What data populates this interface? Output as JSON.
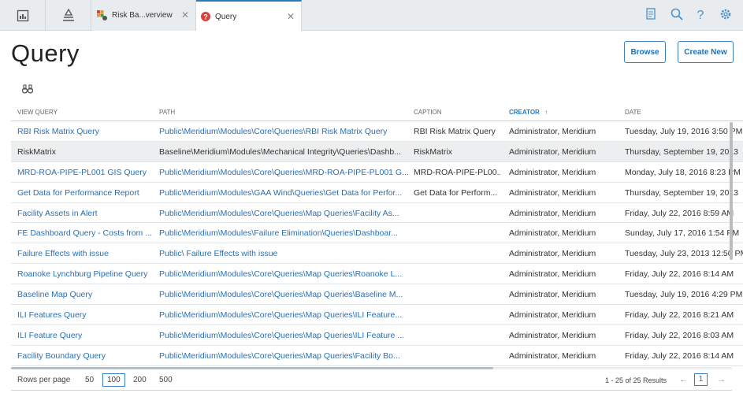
{
  "tabs": {
    "inactive_label": "Risk Ba...verview",
    "active_label": "Query"
  },
  "header": {
    "title": "Query",
    "browse_label": "Browse",
    "create_label": "Create New"
  },
  "table": {
    "columns": [
      "VIEW QUERY",
      "PATH",
      "CAPTION",
      "CREATOR",
      "DATE"
    ],
    "sorted_column": "CREATOR",
    "sort_arrow": "↑",
    "rows": [
      [
        "RBI Risk Matrix Query",
        "Public\\Meridium\\Modules\\Core\\Queries\\RBI Risk Matrix Query",
        "RBI Risk Matrix Query",
        "Administrator, Meridium",
        "Tuesday, July 19, 2016 3:50 PM"
      ],
      [
        "RiskMatrix",
        "Baseline\\Meridium\\Modules\\Mechanical Integrity\\Queries\\Dashb...",
        "RiskMatrix",
        "Administrator, Meridium",
        "Thursday, September 19, 2013"
      ],
      [
        "MRD-ROA-PIPE-PL001 GIS Query",
        "Public\\Meridium\\Modules\\Core\\Queries\\MRD-ROA-PIPE-PL001 G...",
        "MRD-ROA-PIPE-PL00...",
        "Administrator, Meridium",
        "Monday, July 18, 2016 8:23 PM"
      ],
      [
        "Get Data for Performance Report",
        "Public\\Meridium\\Modules\\GAA Wind\\Queries\\Get Data for Perfor...",
        "Get Data for Perform...",
        "Administrator, Meridium",
        "Thursday, September 19, 2013"
      ],
      [
        "Facility Assets in Alert",
        "Public\\Meridium\\Modules\\Core\\Queries\\Map Queries\\Facility As...",
        "",
        "Administrator, Meridium",
        "Friday, July 22, 2016 8:59 AM"
      ],
      [
        "FE Dashboard Query - Costs from ...",
        "Public\\Meridium\\Modules\\Failure Elimination\\Queries\\Dashboar...",
        "",
        "Administrator, Meridium",
        "Sunday, July 17, 2016 1:54 PM"
      ],
      [
        "Failure Effects with issue",
        "Public\\ Failure Effects with issue",
        "",
        "Administrator, Meridium",
        "Tuesday, July 23, 2013 12:50 PM"
      ],
      [
        "Roanoke Lynchburg Pipeline Query",
        "Public\\Meridium\\Modules\\Core\\Queries\\Map Queries\\Roanoke L...",
        "",
        "Administrator, Meridium",
        "Friday, July 22, 2016 8:14 AM"
      ],
      [
        "Baseline Map Query",
        "Public\\Meridium\\Modules\\Core\\Queries\\Map Queries\\Baseline M...",
        "",
        "Administrator, Meridium",
        "Tuesday, July 19, 2016 4:29 PM"
      ],
      [
        "ILI Features Query",
        "Public\\Meridium\\Modules\\Core\\Queries\\Map Queries\\ILI Feature...",
        "",
        "Administrator, Meridium",
        "Friday, July 22, 2016 8:21 AM"
      ],
      [
        "ILI Feature Query",
        "Public\\Meridium\\Modules\\Core\\Queries\\Map Queries\\ILI Feature ...",
        "",
        "Administrator, Meridium",
        "Friday, July 22, 2016 8:03 AM"
      ],
      [
        "Facility Boundary Query",
        "Public\\Meridium\\Modules\\Core\\Queries\\Map Queries\\Facility Bo...",
        "",
        "Administrator, Meridium",
        "Friday, July 22, 2016 8:14 AM"
      ]
    ],
    "selected_row": 1
  },
  "footer": {
    "rows_per_page_label": "Rows per page",
    "options": [
      "50",
      "100",
      "200",
      "500"
    ],
    "selected_option": "100",
    "results_text": "1 - 25 of 25 Results",
    "prev": "←",
    "next": "→",
    "page": "1"
  },
  "colors": {
    "accent": "#2a78bc",
    "link": "#2a6fb1",
    "tab_error": "#d9413b"
  }
}
